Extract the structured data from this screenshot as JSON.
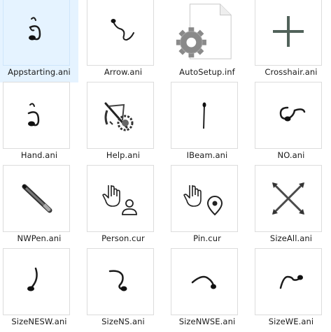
{
  "files": [
    {
      "name": "Appstarting.ani",
      "icon": "appstarting-cursor-icon",
      "selected": true
    },
    {
      "name": "Arrow.ani",
      "icon": "arrow-cursor-icon"
    },
    {
      "name": "AutoSetup.inf",
      "icon": "inf-file-gear-icon"
    },
    {
      "name": "Crosshair.ani",
      "icon": "crosshair-cursor-icon"
    },
    {
      "name": "Hand.ani",
      "icon": "hand-cursor-icon"
    },
    {
      "name": "Help.ani",
      "icon": "help-cursor-icon"
    },
    {
      "name": "IBeam.ani",
      "icon": "ibeam-cursor-icon"
    },
    {
      "name": "NO.ani",
      "icon": "no-cursor-icon"
    },
    {
      "name": "NWPen.ani",
      "icon": "pen-cursor-icon"
    },
    {
      "name": "Person.cur",
      "icon": "person-cursor-icon"
    },
    {
      "name": "Pin.cur",
      "icon": "pin-cursor-icon"
    },
    {
      "name": "SizeAll.ani",
      "icon": "sizeall-cursor-icon"
    },
    {
      "name": "SizeNESW.ani",
      "icon": "sizenesw-cursor-icon"
    },
    {
      "name": "SizeNS.ani",
      "icon": "sizens-cursor-icon"
    },
    {
      "name": "SizeNWSE.ani",
      "icon": "sizenwse-cursor-icon"
    },
    {
      "name": "SizeWE.ani",
      "icon": "sizewe-cursor-icon"
    }
  ],
  "colors": {
    "selection": "#e5f3ff",
    "stroke": "#1c1c1c",
    "gear": "#8a8a8a"
  }
}
